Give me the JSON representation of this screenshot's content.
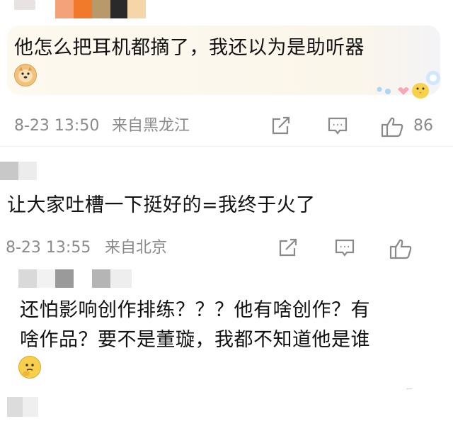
{
  "comments": [
    {
      "text": "他怎么把耳机都摘了，我还以为是助听器",
      "date_time": "8-23 13:50",
      "location": "来自黑龙江",
      "likes": "86"
    },
    {
      "text": "让大家吐槽一下挺好的=我终于火了",
      "date_time": "8-23 13:55",
      "location": "来自北京"
    },
    {
      "text_line1": "还怕影响创作排练？？？他有啥创作？有",
      "text_line2": "啥作品？要不是董璇，我都不知道他是谁"
    }
  ],
  "icons": {
    "share": "share-icon",
    "reply": "comment-icon",
    "like": "thumbs-up-icon",
    "emoji_doge": "doge-emoji-icon",
    "emoji_think": "thinking-emoji-icon",
    "chick": "chick-sticker-icon"
  },
  "colors": {
    "meta_gray": "#8a8a8a",
    "bubble_bg": "#fbf6ea",
    "avatar_orange": "#f07a2a"
  }
}
